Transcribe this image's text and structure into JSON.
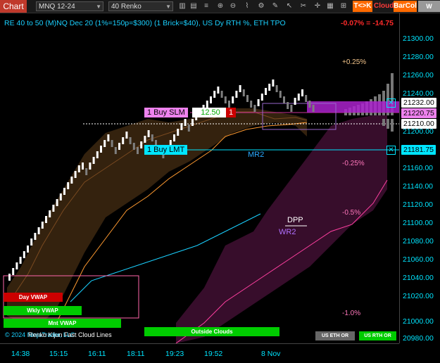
{
  "toolbar": {
    "title": "Chart",
    "instrument": "MNQ 12-24",
    "bar_type": "40 Renko",
    "tk_label": "T<>K",
    "cloud_label": "Cloud",
    "barcol_label": "BarCol",
    "wvwap_label": "W VWA"
  },
  "chart": {
    "title": "RE 40 to 50 (M)NQ Dec 20 (1%=150p=$300) (1 Brick=$40), US Dy RTH %, ETH TPO",
    "pct_change": "-0.07% = -14.75",
    "copyright": "© 2024 NinjaTrader, LLC",
    "legend": "Renko Kijun Fast Cloud Lines"
  },
  "levels": {
    "p025": "+0.25%",
    "m025": "-0.25%",
    "m05": "-0.5%",
    "m10": "-1.0%",
    "mr2": "MR2",
    "dpp": "DPP",
    "wr2": "WR2"
  },
  "orders": {
    "buy_slm": "1 Buy SLM",
    "slm_price": "12.50",
    "slm_qty": "1",
    "buy_lmt": "1 Buy LMT"
  },
  "vwap_buttons": {
    "day": "Day VWAP",
    "wkly": "Wkly VWAP",
    "mnt": "Mnt VWAP",
    "outside": "Outside Clouds",
    "us_eth": "US ETH OR",
    "us_rth": "US RTH OR"
  },
  "y_axis": {
    "ticks": [
      "21300.00",
      "21280.00",
      "21260.00",
      "21240.00",
      "21200.00",
      "21160.00",
      "21140.00",
      "21120.00",
      "21100.00",
      "21080.00",
      "21060.00",
      "21040.00",
      "21020.00",
      "21000.00",
      "20980.00"
    ],
    "badge_top": "21232.00",
    "badge_current": "21220.75",
    "badge_last": "21210.00",
    "badge_lmt": "21181.75"
  },
  "x_axis": {
    "ticks": [
      "14:38",
      "15:15",
      "16:11",
      "18:11",
      "19:23",
      "19:52",
      "8 Nov"
    ]
  },
  "colors": {
    "accent": "#00e5ff",
    "up_brick": "#ffffff",
    "down_brick": "#7f7f7f",
    "buy_order": "#00e5ff",
    "slm_order": "#ee82ee",
    "sell_red": "#cc0000",
    "green_btn": "#00cc00"
  }
}
